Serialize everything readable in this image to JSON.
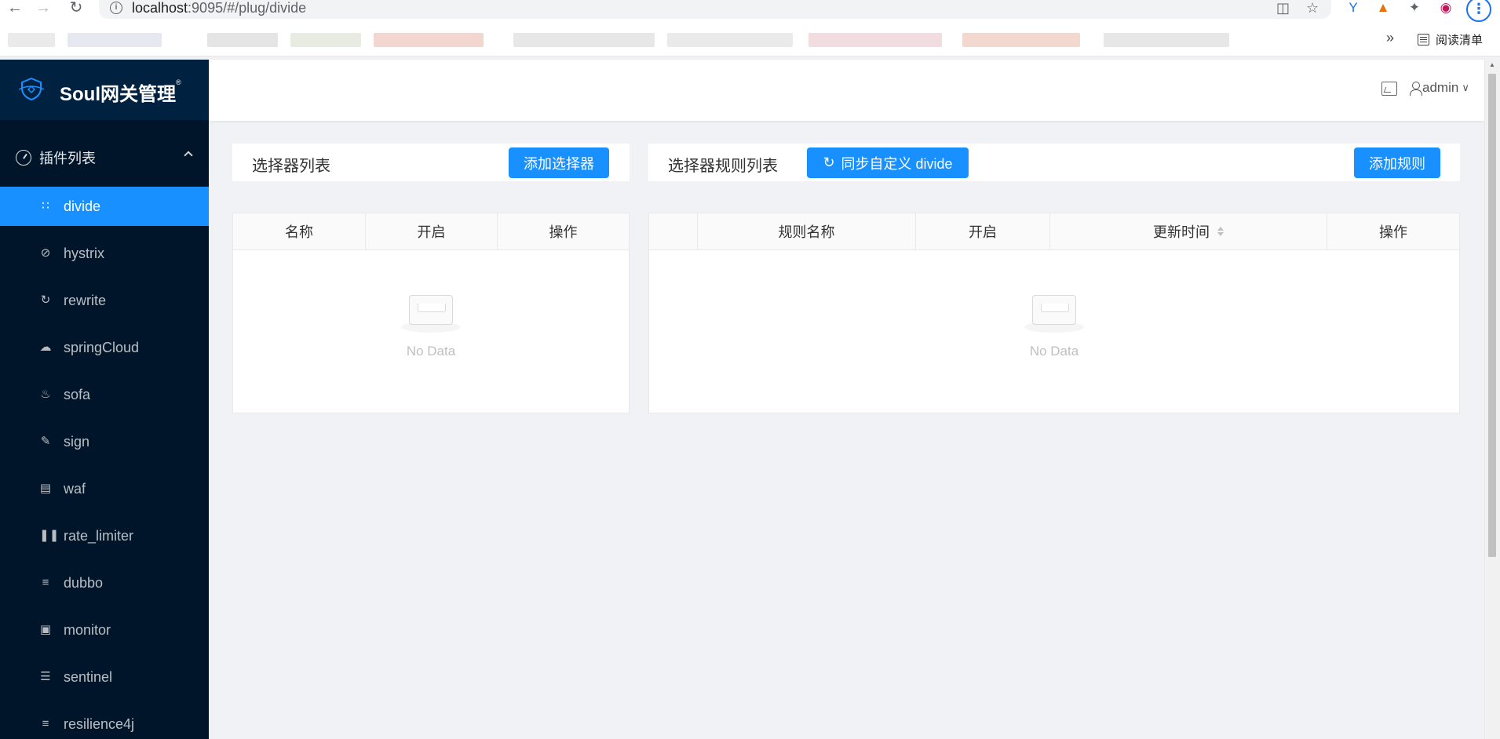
{
  "browser": {
    "url_host": "localhost",
    "url_rest": ":9095/#/plug/divide",
    "reading_list_label": "阅读清单",
    "bookmarks_more": "»"
  },
  "sidebar": {
    "logo_text": "Soul网关管理",
    "logo_sup": "®",
    "submenu_title": "插件列表",
    "items": [
      {
        "label": "divide",
        "icon": "grid-icon",
        "active": true
      },
      {
        "label": "hystrix",
        "icon": "stop-icon"
      },
      {
        "label": "rewrite",
        "icon": "refresh-icon"
      },
      {
        "label": "springCloud",
        "icon": "cloud-icon"
      },
      {
        "label": "sofa",
        "icon": "fire-icon"
      },
      {
        "label": "sign",
        "icon": "highlight-icon"
      },
      {
        "label": "waf",
        "icon": "database-icon"
      },
      {
        "label": "rate_limiter",
        "icon": "pause-icon"
      },
      {
        "label": "dubbo",
        "icon": "align-left-icon"
      },
      {
        "label": "monitor",
        "icon": "camera-icon"
      },
      {
        "label": "sentinel",
        "icon": "border-horizontal-icon"
      },
      {
        "label": "resilience4j",
        "icon": "list-icon"
      }
    ]
  },
  "header": {
    "user": "admin"
  },
  "selector_panel": {
    "title": "选择器列表",
    "add_button": "添加选择器",
    "columns": [
      "名称",
      "开启",
      "操作"
    ],
    "empty_text": "No Data"
  },
  "rule_panel": {
    "title": "选择器规则列表",
    "sync_button": "同步自定义 divide",
    "add_button": "添加规则",
    "columns": [
      "",
      "规则名称",
      "开启",
      "更新时间",
      "操作"
    ],
    "empty_text": "No Data"
  },
  "colors": {
    "primary": "#1890ff",
    "sidebar_bg": "#001529",
    "logo_bg": "#002140"
  }
}
